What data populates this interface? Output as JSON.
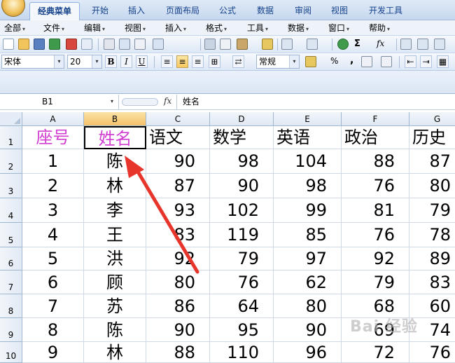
{
  "ribbon_tabs": [
    "经典菜单",
    "开始",
    "插入",
    "页面布局",
    "公式",
    "数据",
    "审阅",
    "视图",
    "开发工具"
  ],
  "menu_items": [
    "全部",
    "文件",
    "编辑",
    "视图",
    "插入",
    "格式",
    "工具",
    "数据",
    "窗口",
    "帮助"
  ],
  "font": {
    "name": "宋体",
    "size": "20"
  },
  "number_format": "常规",
  "format_buttons": {
    "bold": "B",
    "italic": "I",
    "underline": "U"
  },
  "name_box": "B1",
  "fx_label": "fx",
  "formula_value": "姓名",
  "columns": [
    "A",
    "B",
    "C",
    "D",
    "E",
    "F",
    "G"
  ],
  "selected_column": "B",
  "rows": [
    {
      "num": "1",
      "cells": [
        "座号",
        "姓名",
        "语文",
        "数学",
        "英语",
        "政治",
        "历史"
      ]
    },
    {
      "num": "2",
      "cells": [
        "1",
        "陈",
        "90",
        "98",
        "104",
        "88",
        "87"
      ]
    },
    {
      "num": "3",
      "cells": [
        "2",
        "林",
        "87",
        "90",
        "98",
        "76",
        "80"
      ]
    },
    {
      "num": "4",
      "cells": [
        "3",
        "李",
        "93",
        "102",
        "99",
        "81",
        "79"
      ]
    },
    {
      "num": "5",
      "cells": [
        "4",
        "王",
        "83",
        "119",
        "85",
        "76",
        "78"
      ]
    },
    {
      "num": "6",
      "cells": [
        "5",
        "洪",
        "92",
        "79",
        "97",
        "92",
        "89"
      ]
    },
    {
      "num": "7",
      "cells": [
        "6",
        "顾",
        "80",
        "76",
        "62",
        "79",
        "83"
      ]
    },
    {
      "num": "8",
      "cells": [
        "7",
        "苏",
        "86",
        "64",
        "80",
        "68",
        "60"
      ]
    },
    {
      "num": "9",
      "cells": [
        "8",
        "陈",
        "90",
        "95",
        "90",
        "69",
        "74"
      ]
    },
    {
      "num": "10",
      "cells": [
        "9",
        "林",
        "88",
        "110",
        "96",
        "72",
        "76"
      ]
    }
  ],
  "colors": {
    "header_text": "#d23ed2",
    "arrow": "#e8352b",
    "accent": "#15428b"
  },
  "watermark": "Bai 经验"
}
